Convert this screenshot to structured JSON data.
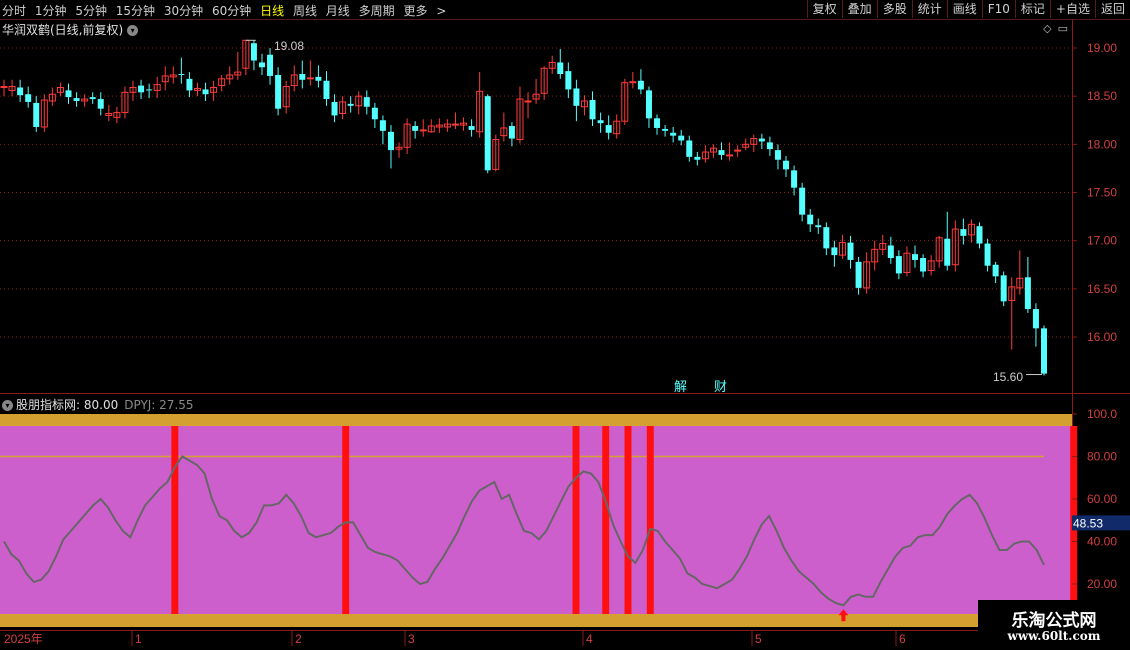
{
  "toolbar": {
    "periods": [
      "分时",
      "1分钟",
      "5分钟",
      "15分钟",
      "30分钟",
      "60分钟",
      "日线",
      "周线",
      "月线",
      "多周期",
      "更多"
    ],
    "active_period": "日线",
    "more_arrow": ">",
    "right_buttons": [
      "复权",
      "叠加",
      "多股",
      "统计",
      "画线",
      "F10",
      "标记",
      "+自选",
      "返回"
    ]
  },
  "stock": {
    "title": "华润双鹤(日线,前复权)",
    "high_label": "19.08",
    "low_label": "15.60",
    "badges": [
      "解",
      "财"
    ]
  },
  "price_axis": [
    "19.00",
    "18.50",
    "18.00",
    "17.50",
    "17.00",
    "16.50",
    "16.00"
  ],
  "indicator": {
    "name": "股朋指标网",
    "value_label": ": 80.00",
    "dpyj": "DPYJ: 27.55",
    "axis": [
      "100.0",
      "80.00",
      "60.00",
      "40.00",
      "20.00"
    ],
    "current_value": "48.53"
  },
  "date_axis": {
    "year_label": "2025年",
    "month_labels": [
      "1",
      "2",
      "3",
      "4",
      "5",
      "6"
    ]
  },
  "watermark": {
    "title": "乐淘公式网",
    "url": "www.60lt.com"
  },
  "colors": {
    "up": "#ff3b3b",
    "down": "#54ffff",
    "panel_fill": "#cc5fcc",
    "band": "#d4a030",
    "signal": "#ff1010",
    "line": "#666666"
  },
  "chart_data": {
    "type": "candlestick",
    "price_ylim": [
      15.6,
      19.08
    ],
    "indicator_ylim": [
      0,
      100
    ],
    "indicator_line_level": 80,
    "indicator_series": [
      40,
      34,
      31,
      25,
      21,
      22,
      26,
      33,
      41,
      45,
      49,
      53,
      57,
      60,
      56,
      50,
      45,
      42,
      50,
      57,
      61,
      65,
      68,
      75,
      80,
      78,
      76,
      72,
      60,
      52,
      50,
      45,
      42,
      44,
      49,
      57,
      57,
      58,
      62,
      58,
      52,
      44,
      42,
      43,
      44,
      47,
      49,
      49,
      43,
      37,
      35,
      34,
      33,
      31,
      27,
      23,
      20,
      21,
      27,
      32,
      38,
      44,
      52,
      59,
      64,
      66,
      68,
      60,
      62,
      53,
      45,
      44,
      41,
      45,
      52,
      59,
      66,
      70,
      73,
      72,
      68,
      59,
      48,
      40,
      33,
      30,
      36,
      46,
      45,
      40,
      36,
      32,
      25,
      23,
      20,
      19,
      18,
      20,
      22,
      27,
      33,
      41,
      48,
      52,
      45,
      37,
      31,
      26,
      23,
      20,
      16,
      13,
      11,
      10,
      14,
      15,
      14,
      14,
      21,
      27,
      33,
      37,
      38,
      42,
      43,
      43,
      47,
      53,
      57,
      60,
      62,
      58,
      51,
      43,
      36,
      36,
      39,
      40,
      40,
      36,
      29
    ],
    "signal_bars_index": [
      23,
      46,
      77,
      81,
      84,
      87,
      144
    ],
    "arrow_index": 113,
    "candles": [
      [
        18.6,
        18.6,
        18.67,
        18.5
      ],
      [
        18.56,
        18.6,
        18.67,
        18.5
      ],
      [
        18.59,
        18.51,
        18.67,
        18.44
      ],
      [
        18.52,
        18.44,
        18.6,
        18.38
      ],
      [
        18.43,
        18.18,
        18.5,
        18.13
      ],
      [
        18.18,
        18.46,
        18.52,
        18.13
      ],
      [
        18.45,
        18.52,
        18.59,
        18.4
      ],
      [
        18.54,
        18.59,
        18.64,
        18.5
      ],
      [
        18.56,
        18.49,
        18.63,
        18.42
      ],
      [
        18.48,
        18.45,
        18.54,
        18.39
      ],
      [
        18.45,
        18.47,
        18.52,
        18.39
      ],
      [
        18.49,
        18.47,
        18.54,
        18.42
      ],
      [
        18.47,
        18.37,
        18.54,
        18.3
      ],
      [
        18.3,
        18.32,
        18.41,
        18.24
      ],
      [
        18.28,
        18.33,
        18.39,
        18.22
      ],
      [
        18.33,
        18.54,
        18.6,
        18.27
      ],
      [
        18.54,
        18.59,
        18.66,
        18.45
      ],
      [
        18.61,
        18.54,
        18.67,
        18.47
      ],
      [
        18.57,
        18.56,
        18.63,
        18.48
      ],
      [
        18.56,
        18.62,
        18.7,
        18.48
      ],
      [
        18.65,
        18.71,
        18.81,
        18.56
      ],
      [
        18.7,
        18.72,
        18.81,
        18.63
      ],
      [
        18.73,
        18.72,
        18.9,
        18.63
      ],
      [
        18.68,
        18.56,
        18.75,
        18.49
      ],
      [
        18.56,
        18.58,
        18.64,
        18.5
      ],
      [
        18.57,
        18.52,
        18.64,
        18.45
      ],
      [
        18.54,
        18.59,
        18.66,
        18.45
      ],
      [
        18.61,
        18.68,
        18.72,
        18.55
      ],
      [
        18.68,
        18.72,
        18.81,
        18.62
      ],
      [
        18.72,
        18.75,
        18.96,
        18.67
      ],
      [
        18.79,
        19.08,
        19.08,
        18.72
      ],
      [
        19.05,
        18.87,
        19.08,
        18.77
      ],
      [
        18.85,
        18.8,
        18.94,
        18.72
      ],
      [
        18.93,
        18.71,
        19.0,
        18.62
      ],
      [
        18.72,
        18.37,
        18.8,
        18.3
      ],
      [
        18.39,
        18.6,
        18.66,
        18.32
      ],
      [
        18.61,
        18.72,
        18.82,
        18.55
      ],
      [
        18.73,
        18.67,
        18.87,
        18.58
      ],
      [
        18.69,
        18.69,
        18.87,
        18.61
      ],
      [
        18.7,
        18.66,
        18.82,
        18.59
      ],
      [
        18.66,
        18.47,
        18.76,
        18.4
      ],
      [
        18.44,
        18.3,
        18.52,
        18.23
      ],
      [
        18.32,
        18.44,
        18.5,
        18.26
      ],
      [
        18.42,
        18.4,
        18.5,
        18.33
      ],
      [
        18.4,
        18.5,
        18.55,
        18.31
      ],
      [
        18.49,
        18.39,
        18.56,
        18.31
      ],
      [
        18.38,
        18.26,
        18.43,
        18.17
      ],
      [
        18.25,
        18.14,
        18.3,
        18.0
      ],
      [
        18.13,
        17.94,
        18.2,
        17.75
      ],
      [
        17.95,
        17.97,
        18.02,
        17.86
      ],
      [
        17.97,
        18.21,
        18.27,
        17.9
      ],
      [
        18.19,
        18.14,
        18.24,
        18.06
      ],
      [
        18.15,
        18.15,
        18.26,
        18.08
      ],
      [
        18.13,
        18.19,
        18.26,
        18.12
      ],
      [
        18.18,
        18.2,
        18.27,
        18.12
      ],
      [
        18.18,
        18.21,
        18.26,
        18.13
      ],
      [
        18.2,
        18.21,
        18.33,
        18.16
      ],
      [
        18.2,
        18.22,
        18.28,
        18.14
      ],
      [
        18.19,
        18.15,
        18.26,
        18.08
      ],
      [
        18.13,
        18.55,
        18.75,
        18.07
      ],
      [
        18.5,
        17.73,
        18.52,
        17.7
      ],
      [
        17.74,
        18.05,
        18.1,
        17.72
      ],
      [
        18.09,
        18.17,
        18.33,
        18.03
      ],
      [
        18.19,
        18.06,
        18.23,
        17.98
      ],
      [
        18.05,
        18.47,
        18.6,
        18.01
      ],
      [
        18.45,
        18.45,
        18.54,
        18.27
      ],
      [
        18.47,
        18.52,
        18.68,
        18.42
      ],
      [
        18.53,
        18.79,
        18.81,
        18.46
      ],
      [
        18.79,
        18.85,
        18.92,
        18.73
      ],
      [
        18.85,
        18.73,
        18.99,
        18.68
      ],
      [
        18.76,
        18.57,
        18.85,
        18.48
      ],
      [
        18.58,
        18.4,
        18.67,
        18.24
      ],
      [
        18.39,
        18.45,
        18.51,
        18.3
      ],
      [
        18.46,
        18.26,
        18.55,
        18.19
      ],
      [
        18.25,
        18.22,
        18.33,
        18.12
      ],
      [
        18.2,
        18.12,
        18.3,
        18.05
      ],
      [
        18.11,
        18.24,
        18.31,
        18.06
      ],
      [
        18.24,
        18.64,
        18.68,
        18.2
      ],
      [
        18.65,
        18.65,
        18.75,
        18.58
      ],
      [
        18.66,
        18.57,
        18.78,
        18.52
      ],
      [
        18.56,
        18.27,
        18.6,
        18.17
      ],
      [
        18.27,
        18.17,
        18.31,
        18.1
      ],
      [
        18.16,
        18.14,
        18.2,
        18.08
      ],
      [
        18.12,
        18.09,
        18.18,
        18.02
      ],
      [
        18.09,
        18.04,
        18.15,
        17.99
      ],
      [
        18.04,
        17.87,
        18.09,
        17.82
      ],
      [
        17.87,
        17.84,
        17.92,
        17.78
      ],
      [
        17.85,
        17.92,
        17.99,
        17.81
      ],
      [
        17.92,
        17.96,
        18.0,
        17.86
      ],
      [
        17.94,
        17.89,
        18.02,
        17.84
      ],
      [
        17.89,
        17.89,
        18.02,
        17.83
      ],
      [
        17.93,
        17.94,
        17.99,
        17.87
      ],
      [
        17.97,
        18.0,
        18.06,
        17.94
      ],
      [
        18.0,
        18.06,
        18.1,
        17.92
      ],
      [
        18.06,
        18.03,
        18.11,
        17.95
      ],
      [
        18.02,
        17.95,
        18.08,
        17.88
      ],
      [
        17.94,
        17.84,
        18.0,
        17.74
      ],
      [
        17.83,
        17.74,
        17.88,
        17.66
      ],
      [
        17.73,
        17.55,
        17.78,
        17.47
      ],
      [
        17.55,
        17.27,
        17.6,
        17.2
      ],
      [
        17.27,
        17.17,
        17.33,
        17.09
      ],
      [
        17.16,
        17.14,
        17.23,
        17.07
      ],
      [
        17.14,
        16.92,
        17.19,
        16.85
      ],
      [
        16.93,
        16.85,
        17.0,
        16.73
      ],
      [
        16.85,
        16.98,
        17.06,
        16.81
      ],
      [
        16.98,
        16.8,
        17.05,
        16.71
      ],
      [
        16.78,
        16.51,
        16.83,
        16.44
      ],
      [
        16.51,
        16.78,
        16.88,
        16.45
      ],
      [
        16.78,
        16.91,
        17.0,
        16.69
      ],
      [
        16.91,
        16.97,
        17.06,
        16.85
      ],
      [
        16.95,
        16.82,
        17.04,
        16.76
      ],
      [
        16.84,
        16.66,
        16.9,
        16.6
      ],
      [
        16.67,
        16.87,
        16.94,
        16.63
      ],
      [
        16.86,
        16.8,
        16.95,
        16.72
      ],
      [
        16.82,
        16.68,
        16.86,
        16.62
      ],
      [
        16.69,
        16.79,
        16.85,
        16.64
      ],
      [
        16.79,
        17.03,
        17.05,
        16.72
      ],
      [
        17.02,
        16.74,
        17.3,
        16.69
      ],
      [
        16.75,
        17.12,
        17.21,
        16.68
      ],
      [
        17.12,
        17.05,
        17.23,
        16.96
      ],
      [
        17.06,
        17.17,
        17.22,
        16.98
      ],
      [
        17.15,
        16.97,
        17.19,
        16.92
      ],
      [
        16.97,
        16.74,
        17.02,
        16.68
      ],
      [
        16.75,
        16.63,
        16.78,
        16.56
      ],
      [
        16.64,
        16.37,
        16.68,
        16.32
      ],
      [
        16.38,
        16.52,
        16.62,
        15.87
      ],
      [
        16.51,
        16.61,
        16.9,
        16.44
      ],
      [
        16.62,
        16.29,
        16.83,
        16.25
      ],
      [
        16.29,
        16.09,
        16.35,
        15.9
      ],
      [
        16.09,
        15.62,
        16.12,
        15.6
      ]
    ]
  }
}
